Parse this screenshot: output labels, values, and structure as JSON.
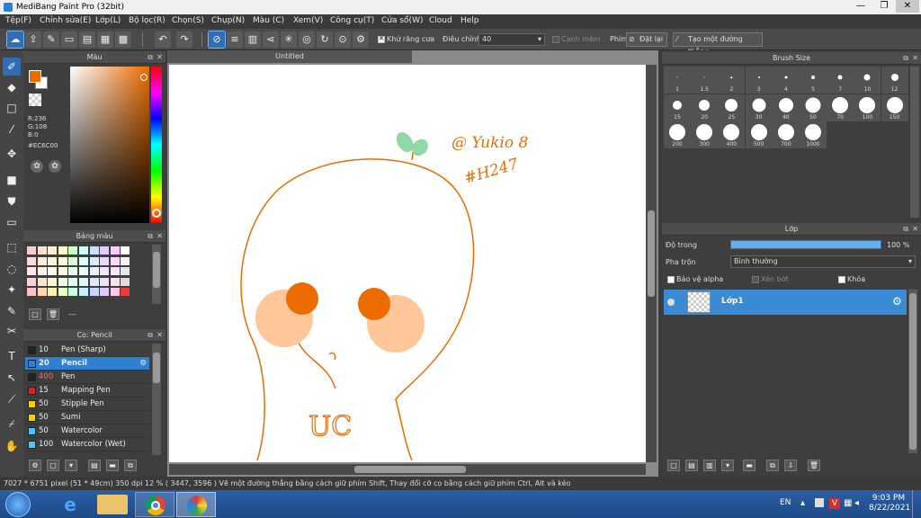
{
  "window": {
    "title": "MediBang Paint Pro (32bit)",
    "minimize": "—",
    "maximize": "❐",
    "close": "✕"
  },
  "menu": [
    "Tệp(F)",
    "Chỉnh sửa(E)",
    "Lớp(L)",
    "Bộ lọc(R)",
    "Chọn(S)",
    "Chụp(N)",
    "Màu (C)",
    "Xem(V)",
    "Công cụ(T)",
    "Cửa sổ(W)",
    "Cloud",
    "Help"
  ],
  "toolbar": {
    "antialias_label": "Khử răng cưa",
    "adjust_label": "Điều chỉnh",
    "adjust_value": "40",
    "edge_label": "Cạnh mềm",
    "pen_label": "Phím",
    "reset_label": "Đặt lại",
    "straight_label": "Tạo một đường thẳng"
  },
  "color_panel": {
    "title": "Màu",
    "r": "R:236",
    "g": "G:108",
    "b": "B:0",
    "hex": "#EC6C00",
    "fg_color": "#EC6C00"
  },
  "palette_panel": {
    "title": "Bảng màu",
    "footer": "---",
    "colors": [
      "#ffcccc",
      "#ffe0cc",
      "#fff0cc",
      "#ffffcc",
      "#ccffcc",
      "#ccffff",
      "#cce0ff",
      "#e0ccff",
      "#ffccff",
      "#ffffff",
      "#ffd9d9",
      "#ffecd9",
      "#fff6d9",
      "#ffffd9",
      "#d9ffd9",
      "#d9ffff",
      "#d9ecff",
      "#ecd9ff",
      "#ffd9ff",
      "#f2f2f2",
      "#ffe6e6",
      "#fff2e6",
      "#fff9e6",
      "#ffffe6",
      "#e6ffe6",
      "#e6ffff",
      "#e6f2ff",
      "#f2e6ff",
      "#ffe6ff",
      "#e8e8e8",
      "#ffd0d8",
      "#ffe4c8",
      "#fffacd",
      "#f0ffe0",
      "#e0fff0",
      "#e0f8ff",
      "#e0e8ff",
      "#f0e0ff",
      "#ffe0f0",
      "#dddddd",
      "#ffc0c8",
      "#ffd8b0",
      "#ffefb0",
      "#eaffc0",
      "#c8ffe0",
      "#c8f0ff",
      "#c8d8ff",
      "#e4c8ff",
      "#ffc8e8",
      "#eb3b3b"
    ]
  },
  "pen_panel": {
    "title": "Cọ: Pencil",
    "pens": [
      {
        "size": "10",
        "name": "Pen (Sharp)",
        "color": "#222222"
      },
      {
        "size": "20",
        "name": "Pencil",
        "color": "#2f80d0"
      },
      {
        "size": "400",
        "name": "Pen",
        "color": "#222222"
      },
      {
        "size": "15",
        "name": "Mapping Pen",
        "color": "#e02020"
      },
      {
        "size": "50",
        "name": "Stipple Pen",
        "color": "#f5d000"
      },
      {
        "size": "50",
        "name": "Sumi",
        "color": "#f5d000"
      },
      {
        "size": "50",
        "name": "Watercolor",
        "color": "#4fc3f7"
      },
      {
        "size": "100",
        "name": "Watercolor (Wet)",
        "color": "#4fc3f7"
      }
    ]
  },
  "canvas": {
    "tab_title": "Untitled",
    "signature_line1": "@ Yukio 8",
    "signature_line2": "#H247",
    "doodle_text": "UC"
  },
  "brush_size_panel": {
    "title": "Brush Size",
    "sizes": [
      {
        "label": "1",
        "d": 1
      },
      {
        "label": "1.5",
        "d": 1
      },
      {
        "label": "2",
        "d": 1.5
      },
      {
        "label": "3",
        "d": 2
      },
      {
        "label": "4",
        "d": 3
      },
      {
        "label": "5",
        "d": 4
      },
      {
        "label": "7",
        "d": 5
      },
      {
        "label": "10",
        "d": 7
      },
      {
        "label": "12",
        "d": 8
      },
      {
        "label": "15",
        "d": 10
      },
      {
        "label": "20",
        "d": 12
      },
      {
        "label": "25",
        "d": 14
      },
      {
        "label": "30",
        "d": 15
      },
      {
        "label": "40",
        "d": 16
      },
      {
        "label": "50",
        "d": 17
      },
      {
        "label": "70",
        "d": 18
      },
      {
        "label": "100",
        "d": 18
      },
      {
        "label": "150",
        "d": 18
      },
      {
        "label": "200",
        "d": 18
      },
      {
        "label": "300",
        "d": 18
      },
      {
        "label": "400",
        "d": 18
      },
      {
        "label": "500",
        "d": 18
      },
      {
        "label": "700",
        "d": 18
      },
      {
        "label": "1000",
        "d": 18
      }
    ]
  },
  "layer_panel": {
    "title": "Lớp",
    "opacity_label": "Độ trong",
    "opacity_value": "100 %",
    "opacity_fraction": 1.0,
    "blend_label": "Pha trộn",
    "blend_value": "Bình thường",
    "protect_alpha": "Bảo vệ alpha",
    "clipping": "Xén bớt",
    "lock": "Khóa",
    "layers": [
      {
        "name": "Lớp1"
      }
    ]
  },
  "status": {
    "text": "7027 * 6751 pixel   (51 * 49cm)   350 dpi   12 %   ( 3447, 3596 )   Vẽ một đường thẳng bằng cách giữ phím Shift, Thay đổi cỡ cọ bằng cách giữ phím Ctrl, Alt và kéo"
  },
  "taskbar": {
    "lang": "EN",
    "time": "9:03 PM",
    "date": "8/22/2021"
  }
}
